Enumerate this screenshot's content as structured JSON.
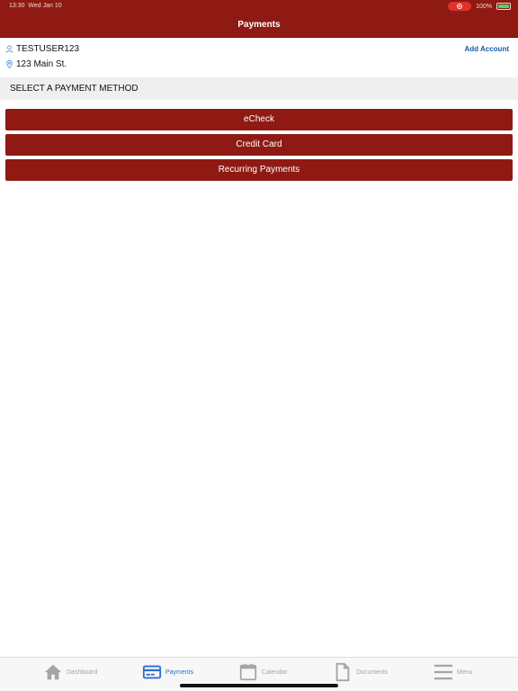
{
  "status": {
    "time": "13:30",
    "date": "Wed Jan 10",
    "battery": "100%"
  },
  "header": {
    "title": "Payments"
  },
  "account": {
    "username": "TESTUSER123",
    "address": "123 Main St.",
    "add_account_label": "Add Account"
  },
  "section": {
    "title": "SELECT A PAYMENT METHOD"
  },
  "methods": [
    {
      "label": "eCheck"
    },
    {
      "label": "Credit Card"
    },
    {
      "label": "Recurring Payments"
    }
  ],
  "tabs": [
    {
      "label": "Dashboard",
      "icon": "home-icon"
    },
    {
      "label": "Payments",
      "icon": "credit-card-icon",
      "active": true
    },
    {
      "label": "Calendar",
      "icon": "calendar-icon"
    },
    {
      "label": "Documents",
      "icon": "document-icon"
    },
    {
      "label": "Menu",
      "icon": "menu-icon"
    }
  ],
  "colors": {
    "primary": "#8e1a13",
    "link": "#1a5aa0",
    "active_tab": "#2f6fd1",
    "inactive_tab": "#a5a5a5"
  }
}
